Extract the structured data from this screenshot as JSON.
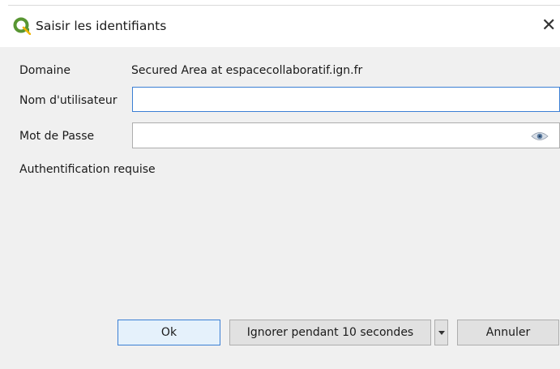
{
  "window": {
    "title": "Saisir les identifiants",
    "close_glyph": "✕",
    "icon": "qgis-logo-icon"
  },
  "form": {
    "domain_label": "Domaine",
    "domain_value": "Secured Area at espacecollaboratif.ign.fr",
    "username_label": "Nom d'utilisateur",
    "username_value": "",
    "password_label": "Mot de Passe",
    "password_value": "",
    "status_text": "Authentification requise"
  },
  "buttons": {
    "ok_label": "Ok",
    "ignore_label": "Ignorer pendant 10 secondes",
    "cancel_label": "Annuler"
  },
  "colors": {
    "accent": "#3b7fd4",
    "qgis_green": "#589632"
  }
}
